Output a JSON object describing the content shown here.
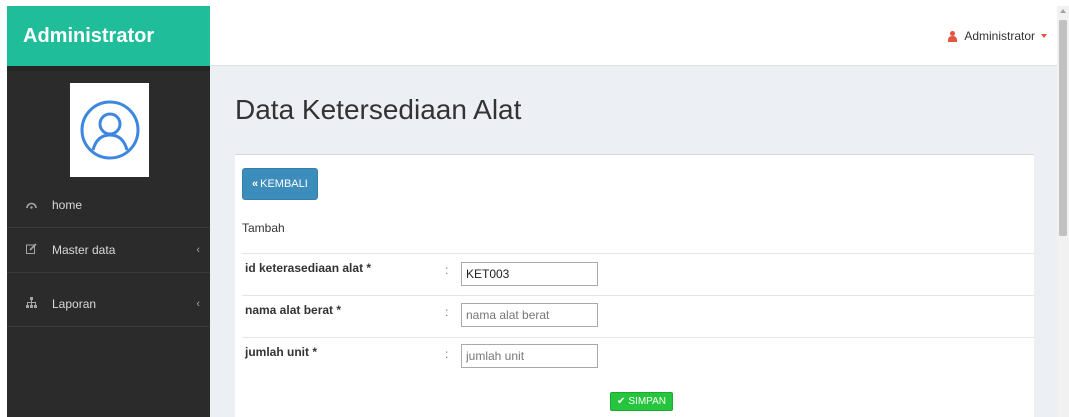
{
  "brand": {
    "title": "Administrator"
  },
  "user_menu": {
    "label": "Administrator",
    "icon": "user-icon",
    "accent": "#e2553f"
  },
  "sidebar": {
    "items": [
      {
        "label": "home",
        "icon": "dashboard-icon"
      },
      {
        "label": "Master data",
        "icon": "edit-icon",
        "chevron": "‹"
      },
      {
        "label": "Laporan",
        "icon": "sitemap-icon",
        "chevron": "‹"
      }
    ]
  },
  "page": {
    "title": "Data Ketersediaan Alat"
  },
  "form": {
    "back_label": "KEMBALI",
    "back_icon_glyph": "«",
    "subtitle": "Tambah",
    "colon": ":",
    "fields": [
      {
        "label": "id keterasediaan alat *",
        "value": "KET003",
        "placeholder": ""
      },
      {
        "label": "nama alat berat *",
        "value": "",
        "placeholder": "nama alat berat"
      },
      {
        "label": "jumlah unit *",
        "value": "",
        "placeholder": "jumlah unit"
      }
    ],
    "save_label": "SIMPAN",
    "save_icon_glyph": "✔"
  },
  "colors": {
    "brand_bg": "#1fbd9a",
    "sidebar_bg": "#2b2b2b",
    "back_button": "#3c8dbc",
    "save_button": "#25c53e"
  }
}
